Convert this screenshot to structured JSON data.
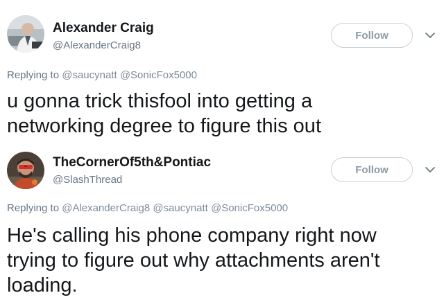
{
  "tweets": [
    {
      "display_name": "Alexander Craig",
      "handle": "@AlexanderCraig8",
      "follow_label": "Follow",
      "replying_prefix": "Replying to",
      "mentions": [
        "@saucynatt",
        "@SonicFox5000"
      ],
      "text_lines": [
        "u gonna trick thisfool into getting a",
        "networking degree to figure this out"
      ]
    },
    {
      "display_name": "TheCornerOf5th&Pontiac",
      "handle": "@SlashThread",
      "follow_label": "Follow",
      "replying_prefix": "Replying to",
      "mentions": [
        "@AlexanderCraig8",
        "@saucynatt",
        "@SonicFox5000"
      ],
      "text_lines": [
        "He's calling his phone company right now",
        "trying to figure out why attachments aren't",
        "loading."
      ]
    }
  ],
  "icons": {
    "avatar1": "avatar-man-at-desk",
    "avatar2": "avatar-man-red-sunglasses",
    "menu": "chevron-down-icon"
  },
  "colors": {
    "text": "#14171a",
    "secondary": "#657786",
    "follow_border": "#c7d0d8",
    "follow_text": "#8d9aa5"
  }
}
